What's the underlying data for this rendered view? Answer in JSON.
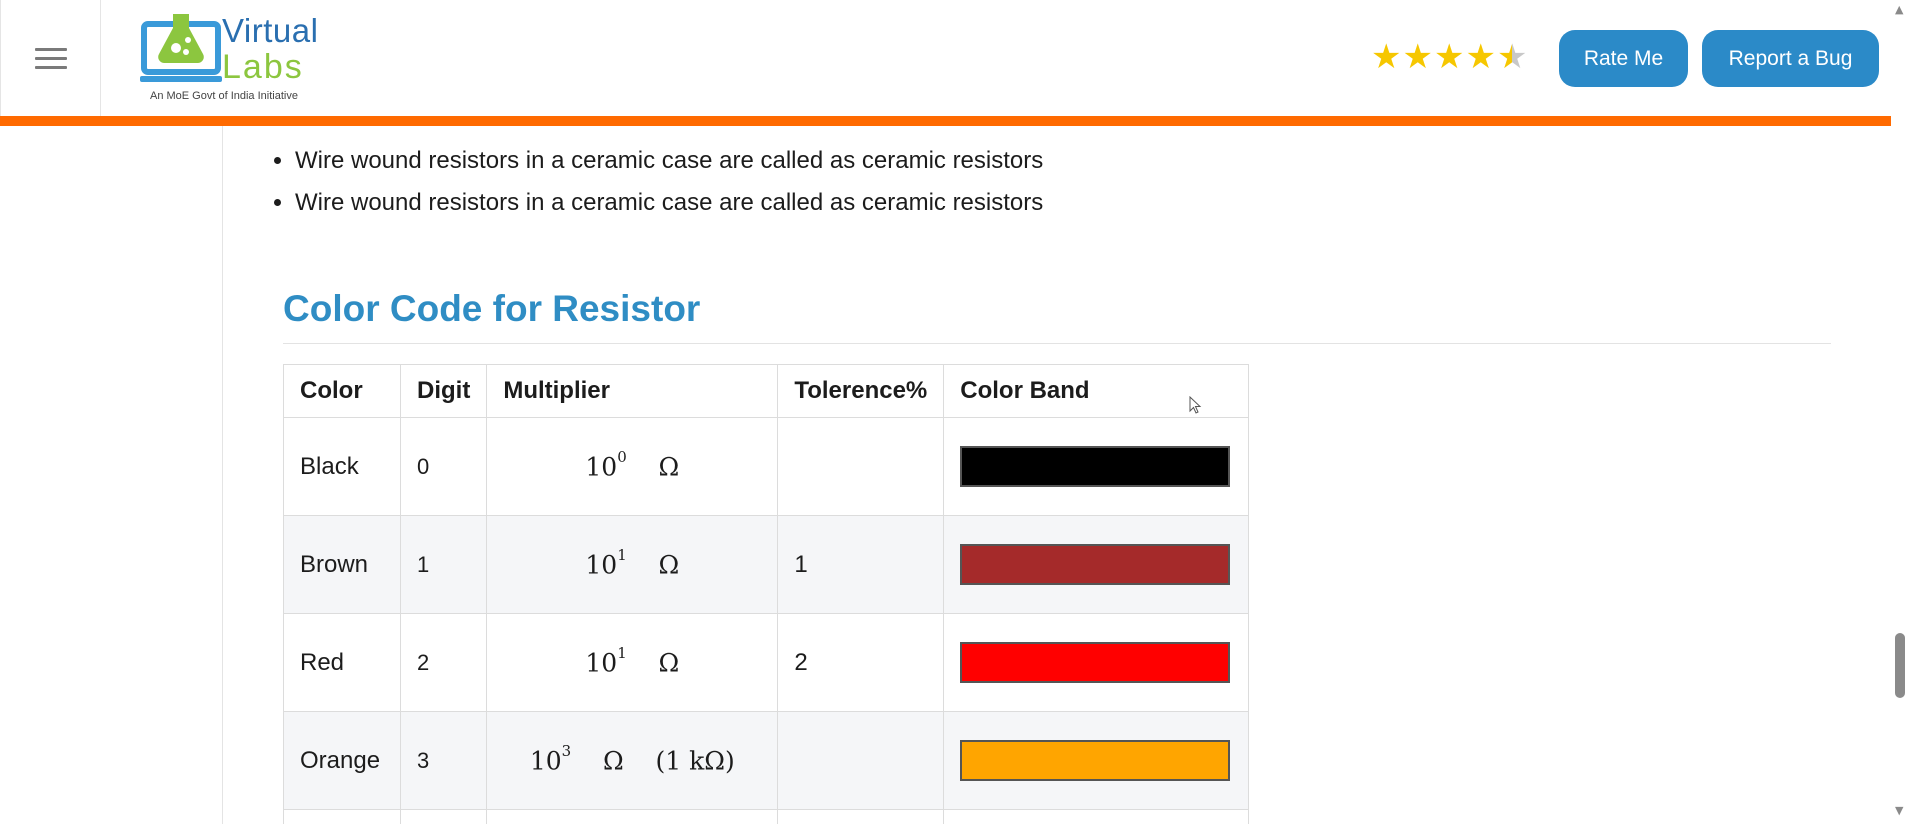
{
  "header": {
    "logo": {
      "title_line1": "Virtual",
      "title_line2": "Labs",
      "subtitle": "An MoE Govt of India Initiative"
    },
    "rating": 4.5,
    "rate_button": "Rate Me",
    "bug_button": "Report a Bug"
  },
  "content": {
    "bullets": [
      "Wire wound resistors in a ceramic case are called as ceramic resistors",
      "Wire wound resistors in a ceramic case are called as ceramic resistors"
    ],
    "section_title": "Color Code for Resistor",
    "table": {
      "headers": [
        "Color",
        "Digit",
        "Multiplier",
        "Tolerence%",
        "Color Band"
      ],
      "rows": [
        {
          "color": "Black",
          "digit": "0",
          "mult_base": "10",
          "mult_exp": "0",
          "mult_unit": "Ω",
          "mult_extra": "",
          "tolerance": "",
          "band_color": "#000000"
        },
        {
          "color": "Brown",
          "digit": "1",
          "mult_base": "10",
          "mult_exp": "1",
          "mult_unit": "Ω",
          "mult_extra": "",
          "tolerance": "1",
          "band_color": "#a52a2a"
        },
        {
          "color": "Red",
          "digit": "2",
          "mult_base": "10",
          "mult_exp": "1",
          "mult_unit": "Ω",
          "mult_extra": "",
          "tolerance": "2",
          "band_color": "#ff0000"
        },
        {
          "color": "Orange",
          "digit": "3",
          "mult_base": "10",
          "mult_exp": "3",
          "mult_unit": "Ω",
          "mult_extra": "(1  kΩ)",
          "tolerance": "",
          "band_color": "#ffa500"
        }
      ]
    }
  },
  "colors": {
    "accent_orange": "#ff6a00",
    "button_blue": "#2b8ac8",
    "title_blue": "#2f8dc4",
    "star_gold": "#f6c700"
  }
}
